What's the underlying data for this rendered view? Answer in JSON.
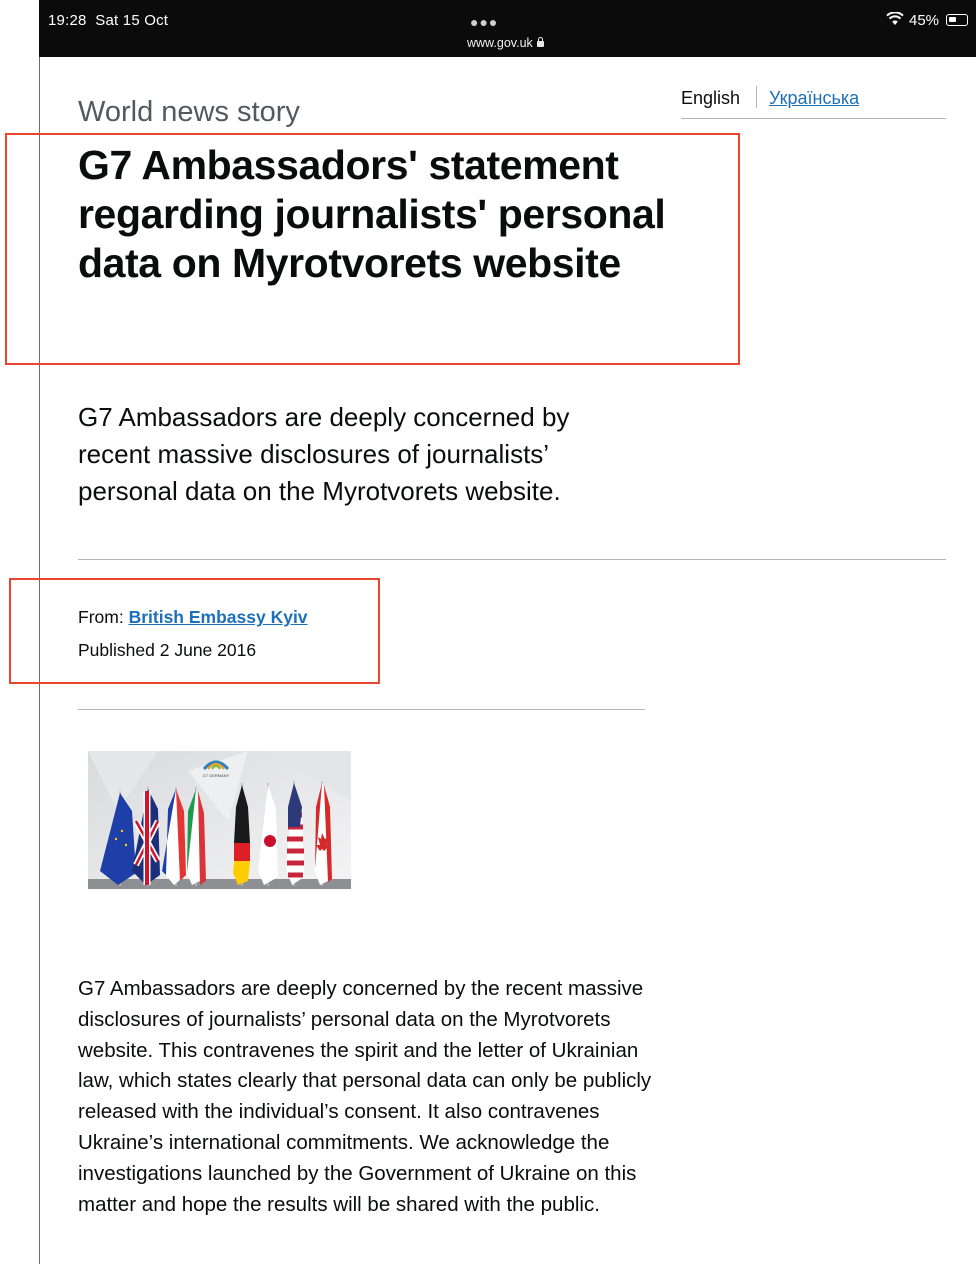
{
  "status_bar": {
    "time": "19:28",
    "date": "Sat 15 Oct",
    "url": "www.gov.uk",
    "battery": "45%",
    "battery_level": 0.45
  },
  "language": {
    "current": "English",
    "alternate": "Українська"
  },
  "article": {
    "caption": "World news story",
    "title": "G7 Ambassadors' statement regarding journalists' personal data on Myrotvorets website",
    "lead": "G7 Ambassadors are deeply concerned by recent massive disclosures of journalists’ personal data on the Myrotvorets website.",
    "from_label": "From:",
    "from_org": "British Embassy Kyiv",
    "published_label": "Published",
    "published_date": "2 June 2016",
    "body": "G7 Ambassadors are deeply concerned by the recent massive disclosures of journalists’ personal data on the Myrotvorets website. This contravenes the spirit and the letter of Ukrainian law, which states clearly that personal data can only be publicly released with the individual’s consent. It also contravenes Ukraine’s international commitments. We acknowledge the investigations launched by the Government of Ukraine on this matter and hope the results will be shared with the public."
  },
  "image": {
    "logo_text": "G7 GERMANY"
  },
  "colors": {
    "link": "#1d70b8",
    "highlight": "#e8462f",
    "status_bar": "#0b0b0b"
  },
  "icons": [
    "lock-icon",
    "wifi-icon",
    "battery-icon"
  ]
}
